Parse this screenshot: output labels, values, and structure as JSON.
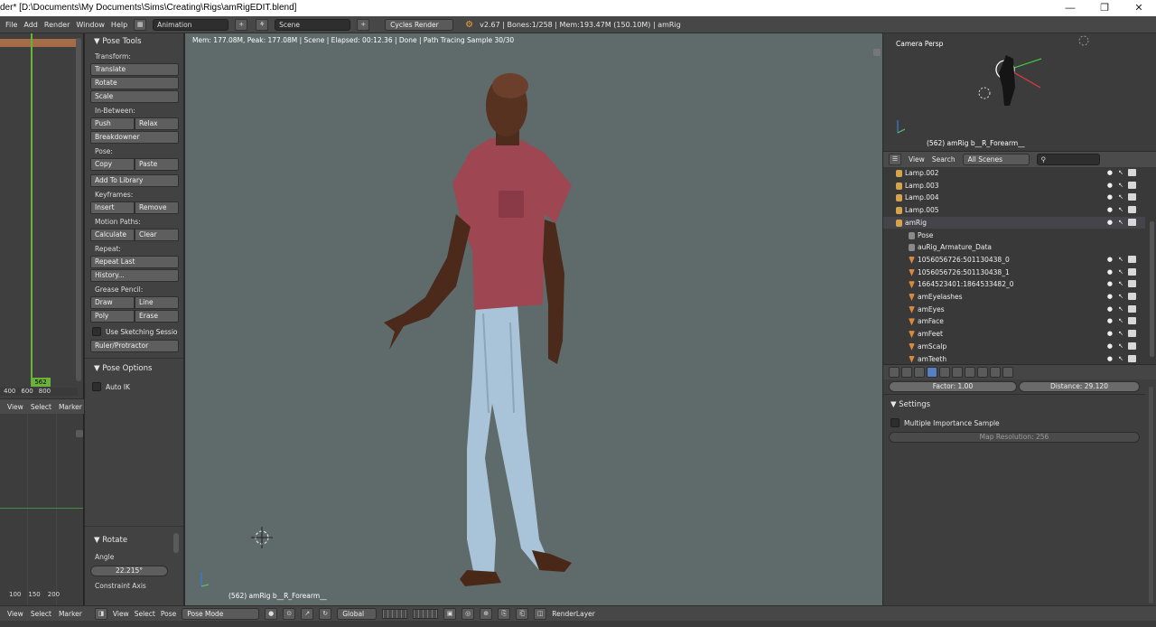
{
  "window": {
    "title": "der* [D:\\Documents\\My Documents\\Sims\\Creating\\Rigs\\amRigEDIT.blend]",
    "controls": [
      "—",
      "❐",
      "✕"
    ]
  },
  "topbar": {
    "menu": [
      "File",
      "Add",
      "Render",
      "Window",
      "Help"
    ],
    "layout_value": "Animation",
    "scene_value": "Scene",
    "render_engine": "Cycles Render",
    "stats": "v2.67 | Bones:1/258 | Mem:193.47M (150.10M) | amRig"
  },
  "timeline": {
    "current_frame": "562",
    "ruler": [
      "400",
      "600",
      "800"
    ],
    "header": [
      "View",
      "Select",
      "Marker"
    ]
  },
  "graph": {
    "ruler": [
      "100",
      "150",
      "200"
    ],
    "header": [
      "View",
      "Select",
      "Marker"
    ]
  },
  "toolshelf": {
    "pose_tools_title": "▼ Pose Tools",
    "transform_label": "Transform:",
    "translate": "Translate",
    "rotate": "Rotate",
    "scale": "Scale",
    "inbetween_label": "In-Between:",
    "push": "Push",
    "relax": "Relax",
    "breakdowner": "Breakdowner",
    "pose_label": "Pose:",
    "copy": "Copy",
    "paste": "Paste",
    "add_to_library": "Add To Library",
    "keyframes_label": "Keyframes:",
    "insert": "Insert",
    "remove": "Remove",
    "motion_paths_label": "Motion Paths:",
    "calculate": "Calculate",
    "clear": "Clear",
    "repeat_label": "Repeat:",
    "repeat_last": "Repeat Last",
    "history": "History...",
    "grease_pencil_label": "Grease Pencil:",
    "draw": "Draw",
    "line": "Line",
    "poly": "Poly",
    "erase": "Erase",
    "use_sketching": "Use Sketching Sessio",
    "ruler_protractor": "Ruler/Protractor",
    "pose_options_title": "▼ Pose Options",
    "auto_ik": "Auto IK",
    "rotate_panel_title": "▼ Rotate",
    "angle_label": "Angle",
    "angle_value": "22.215°",
    "constraint_axis": "Constraint Axis"
  },
  "viewport": {
    "info": "Mem: 177.08M, Peak: 177.08M | Scene | Elapsed: 00:12.36 | Done | Path Tracing Sample 30/30",
    "selected": "(562) amRig b__R_Forearm__"
  },
  "camera_view": {
    "label": "Camera Persp",
    "selected": "(562) amRig b__R_Forearm__"
  },
  "outliner": {
    "header": [
      "View",
      "Search"
    ],
    "scenes_select": "All Scenes",
    "rows": [
      {
        "name": "Lamp.002",
        "kind": "lamp",
        "indent": 0
      },
      {
        "name": "Lamp.003",
        "kind": "lamp",
        "indent": 0
      },
      {
        "name": "Lamp.004",
        "kind": "lamp",
        "indent": 0
      },
      {
        "name": "Lamp.005",
        "kind": "lamp",
        "indent": 0
      },
      {
        "name": "amRig",
        "kind": "armature",
        "indent": 0
      },
      {
        "name": "Pose",
        "kind": "pose",
        "indent": 1
      },
      {
        "name": "auRig_Armature_Data",
        "kind": "data",
        "indent": 1
      },
      {
        "name": "1056056726:501130438_0",
        "kind": "mesh",
        "indent": 1
      },
      {
        "name": "1056056726:501130438_1",
        "kind": "mesh",
        "indent": 1
      },
      {
        "name": "1664523401:1864533482_0",
        "kind": "mesh",
        "indent": 1
      },
      {
        "name": "amEyelashes",
        "kind": "mesh",
        "indent": 1
      },
      {
        "name": "amEyes",
        "kind": "mesh",
        "indent": 1
      },
      {
        "name": "amFace",
        "kind": "mesh",
        "indent": 1
      },
      {
        "name": "amFeet",
        "kind": "mesh",
        "indent": 1
      },
      {
        "name": "amScalp",
        "kind": "mesh",
        "indent": 1
      },
      {
        "name": "amTeeth",
        "kind": "mesh",
        "indent": 1
      }
    ]
  },
  "properties": {
    "factor": "Factor: 1.00",
    "distance": "Distance: 29.120",
    "settings_title": "▼ Settings",
    "multiple_importance": "Multiple Importance Sample",
    "map_resolution": "Map Resolution: 256"
  },
  "bottombar": {
    "menu": [
      "View",
      "Select",
      "Pose"
    ],
    "mode": "Pose Mode",
    "orientation": "Global",
    "render_layer": "RenderLayer"
  },
  "colors": {
    "viewport_bg": "#5f6a6a",
    "frame_marker": "#6bb23d",
    "active_tab": "#5680c2"
  }
}
